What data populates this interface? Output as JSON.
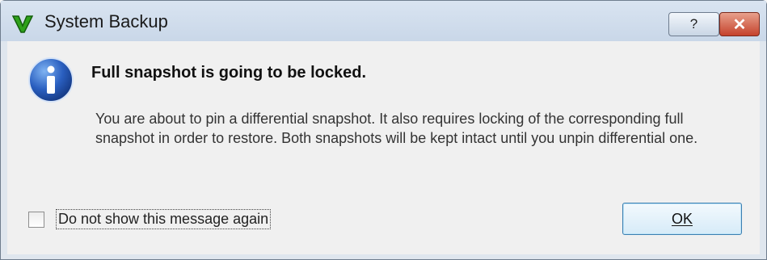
{
  "window": {
    "title": "System Backup",
    "app_icon": "green-v-icon"
  },
  "titlebar_buttons": {
    "help_label": "?",
    "close_label": "✕"
  },
  "dialog": {
    "icon": "info-icon",
    "heading": "Full snapshot is going to be locked.",
    "message": "You are about to pin a differential snapshot. It also requires locking of the corresponding full snapshot in order to restore. Both snapshots will be kept intact until you unpin differential one.",
    "checkbox_label": "Do not show this message again",
    "checkbox_checked": false,
    "ok_label": "OK"
  }
}
